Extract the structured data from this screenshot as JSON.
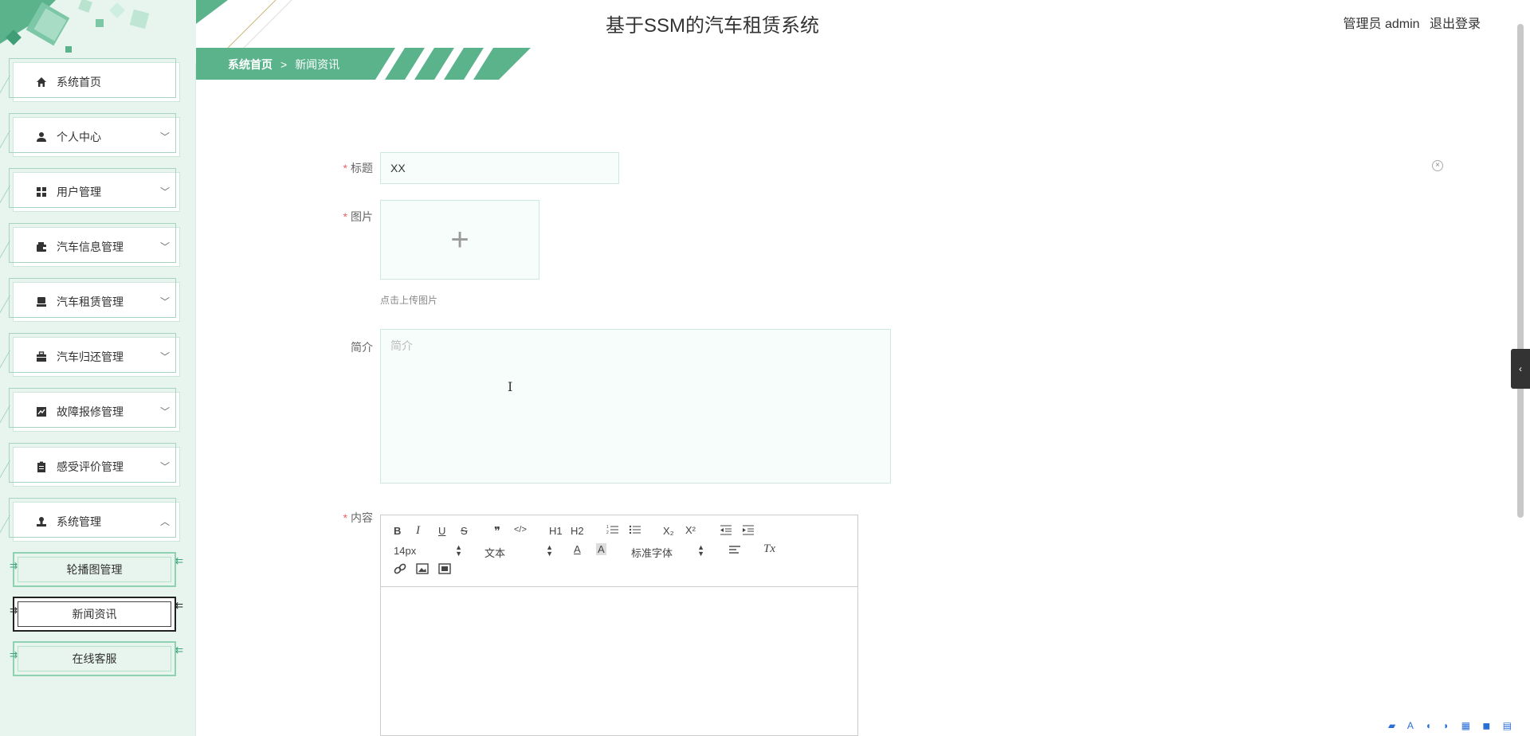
{
  "app": {
    "title": "基于SSM的汽车租赁系统",
    "role": "管理员 admin",
    "logout": "退出登录"
  },
  "breadcrumb": {
    "home": "系统首页",
    "separator": ">",
    "current": "新闻资讯"
  },
  "sidebar": {
    "items": [
      {
        "label": "系统首页",
        "icon": "home-icon"
      },
      {
        "label": "个人中心",
        "icon": "user-icon"
      },
      {
        "label": "用户管理",
        "icon": "grid-icon"
      },
      {
        "label": "汽车信息管理",
        "icon": "wallet-icon"
      },
      {
        "label": "汽车租赁管理",
        "icon": "monitor-icon"
      },
      {
        "label": "汽车归还管理",
        "icon": "briefcase-icon"
      },
      {
        "label": "故障报修管理",
        "icon": "chart-icon"
      },
      {
        "label": "感受评价管理",
        "icon": "clipboard-icon"
      },
      {
        "label": "系统管理",
        "icon": "stamp-icon"
      }
    ],
    "submenu": [
      {
        "label": "轮播图管理"
      },
      {
        "label": "新闻资讯"
      },
      {
        "label": "在线客服"
      }
    ],
    "active": "新闻资讯"
  },
  "form": {
    "title_label": "标题",
    "title_value": "XX",
    "image_label": "图片",
    "upload_hint": "点击上传图片",
    "intro_label": "简介",
    "intro_placeholder": "简介",
    "content_label": "内容",
    "required_mark": "*"
  },
  "editor": {
    "font_size": "14px",
    "block_format": "文本",
    "font_family": "标准字体",
    "buttons": [
      "B",
      "I",
      "U",
      "S",
      "❞",
      "</>",
      "H1",
      "H2",
      "ordered-list",
      "bullet-list",
      "X₂",
      "X²",
      "outdent",
      "indent"
    ]
  },
  "colors": {
    "accent": "#5bb38c",
    "sidebar_bg": "#e8f5ef",
    "required": "#e46464"
  }
}
